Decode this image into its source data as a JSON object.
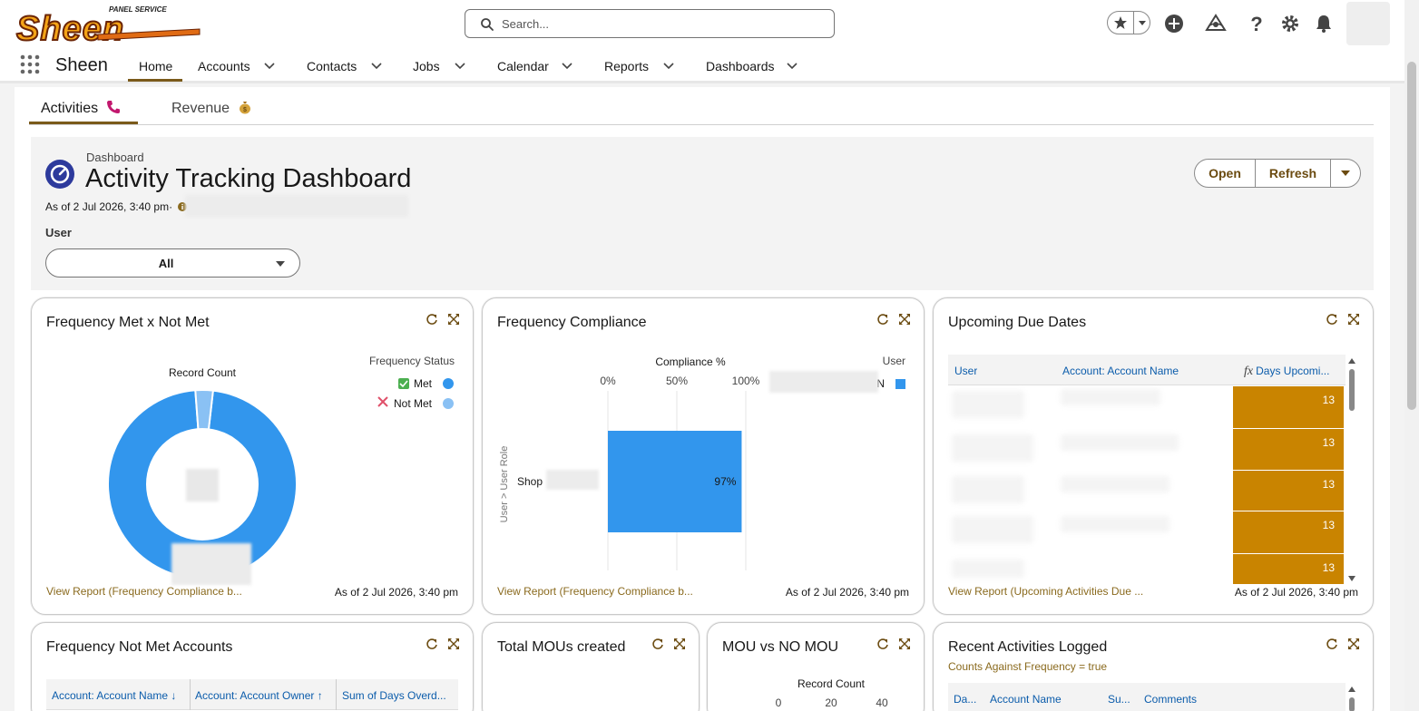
{
  "header": {
    "logo_text": "Sheen",
    "logo_subtext": "PANEL SERVICE",
    "search_placeholder": "Search..."
  },
  "nav": {
    "app_name": "Sheen",
    "items": [
      {
        "label": "Home",
        "active": true,
        "has_menu": false
      },
      {
        "label": "Accounts",
        "has_menu": true
      },
      {
        "label": "Contacts",
        "has_menu": true
      },
      {
        "label": "Jobs",
        "has_menu": true
      },
      {
        "label": "Calendar",
        "has_menu": true
      },
      {
        "label": "Reports",
        "has_menu": true
      },
      {
        "label": "Dashboards",
        "has_menu": true
      }
    ]
  },
  "tabs": [
    {
      "label": "Activities",
      "icon": "phone-icon",
      "active": true
    },
    {
      "label": "Revenue",
      "icon": "money-bag-icon",
      "active": false
    }
  ],
  "dashboard": {
    "label": "Dashboard",
    "title": "Activity Tracking Dashboard",
    "as_of": "As of 2 Jul 2026, 3:40 pm·",
    "filter_label": "User",
    "filter_value": "All",
    "buttons": {
      "open": "Open",
      "refresh": "Refresh"
    }
  },
  "cards": {
    "freq_met": {
      "title": "Frequency Met x Not Met",
      "chart_title": "Record Count",
      "legend_title": "Frequency Status",
      "legend": [
        {
          "label": "Met",
          "color": "#3296ed"
        },
        {
          "label": "Not Met",
          "color": "#8ac1f4"
        }
      ],
      "link": "View Report (Frequency Compliance b...",
      "date": "As of 2 Jul 2026, 3:40 pm"
    },
    "freq_compliance": {
      "title": "Frequency Compliance",
      "axis_title": "Compliance %",
      "ticks": [
        "0%",
        "50%",
        "100%"
      ],
      "y_axis_label": "User > User Role",
      "category": "Shop",
      "legend_title": "User",
      "legend_item": "N",
      "bar_label": "97%",
      "link": "View Report (Frequency Compliance b...",
      "date": "As of 2 Jul 2026, 3:40 pm"
    },
    "upcoming": {
      "title": "Upcoming Due Dates",
      "columns": [
        "User",
        "Account: Account Name",
        "Days Upcomi..."
      ],
      "values": [
        "13",
        "13",
        "13",
        "13",
        "13"
      ],
      "link": "View Report (Upcoming Activities Due ...",
      "date": "As of 2 Jul 2026, 3:40 pm"
    },
    "not_met_accounts": {
      "title": "Frequency Not Met Accounts",
      "columns": [
        "Account: Account Name",
        "Account: Account Owner",
        "Sum of Days Overd..."
      ]
    },
    "total_mous": {
      "title": "Total MOUs created"
    },
    "mou_vs": {
      "title": "MOU vs NO MOU",
      "chart_title": "Record Count",
      "ticks": [
        "0",
        "20",
        "40"
      ]
    },
    "recent": {
      "title": "Recent Activities Logged",
      "filter": "Counts Against Frequency = true",
      "columns": [
        "Da...",
        "Account Name",
        "Su...",
        "Comments"
      ]
    }
  },
  "chart_data": [
    {
      "type": "pie",
      "title": "Record Count",
      "legend_title": "Frequency Status",
      "categories": [
        "Met",
        "Not Met"
      ],
      "values": [
        97,
        3
      ],
      "colors": [
        "#3296ed",
        "#8ac1f4"
      ],
      "legend_placement": "top-right",
      "donut": true
    },
    {
      "type": "bar",
      "orientation": "horizontal",
      "title": "Compliance %",
      "xlabel": "Compliance %",
      "ylabel": "User > User Role",
      "categories": [
        "Shop"
      ],
      "values": [
        97
      ],
      "xlim": [
        0,
        100
      ],
      "ticks": [
        "0%",
        "50%",
        "100%"
      ],
      "color": "#3296ed",
      "grid": true,
      "legend_placement": "top-right"
    }
  ]
}
